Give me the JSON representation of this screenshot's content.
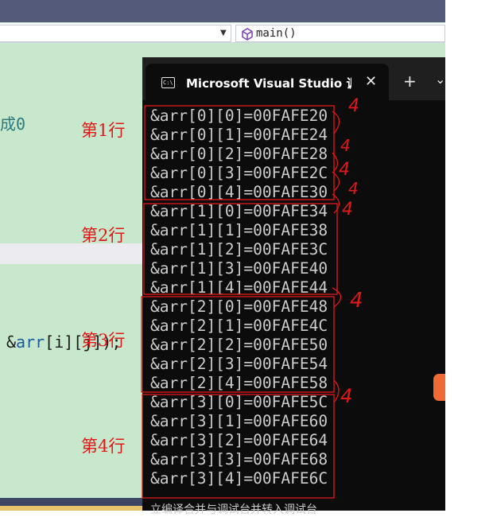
{
  "ide": {
    "function_selector": "main()",
    "code_fragment_top": "成0",
    "code_fragment_call": {
      "amp": "&",
      "var": "arr",
      "rest": "[i][j]);"
    }
  },
  "annotations": {
    "row_labels": [
      "第1行",
      "第2行",
      "第3行",
      "第4行"
    ],
    "offset_mark": "4"
  },
  "console": {
    "tab_title": "Microsoft Visual Studio 调试控制台",
    "tab_icon_text": "C:\\",
    "lines": [
      "&arr[0][0]=00FAFE20",
      "&arr[0][1]=00FAFE24",
      "&arr[0][2]=00FAFE28",
      "&arr[0][3]=00FAFE2C",
      "&arr[0][4]=00FAFE30",
      "&arr[1][0]=00FAFE34",
      "&arr[1][1]=00FAFE38",
      "&arr[1][2]=00FAFE3C",
      "&arr[1][3]=00FAFE40",
      "&arr[1][4]=00FAFE44",
      "&arr[2][0]=00FAFE48",
      "&arr[2][1]=00FAFE4C",
      "&arr[2][2]=00FAFE50",
      "&arr[2][3]=00FAFE54",
      "&arr[2][4]=00FAFE58",
      "&arr[3][0]=00FAFE5C",
      "&arr[3][1]=00FAFE60",
      "&arr[3][2]=00FAFE64",
      "&arr[3][3]=00FAFE68",
      "&arr[3][4]=00FAFE6C"
    ],
    "tail_text": "立编译合并与调试台并转入调试台"
  },
  "colors": {
    "ide_background": "#c7e8cc",
    "console_background": "#0c0c0c",
    "annotation_red": "#e01818"
  }
}
